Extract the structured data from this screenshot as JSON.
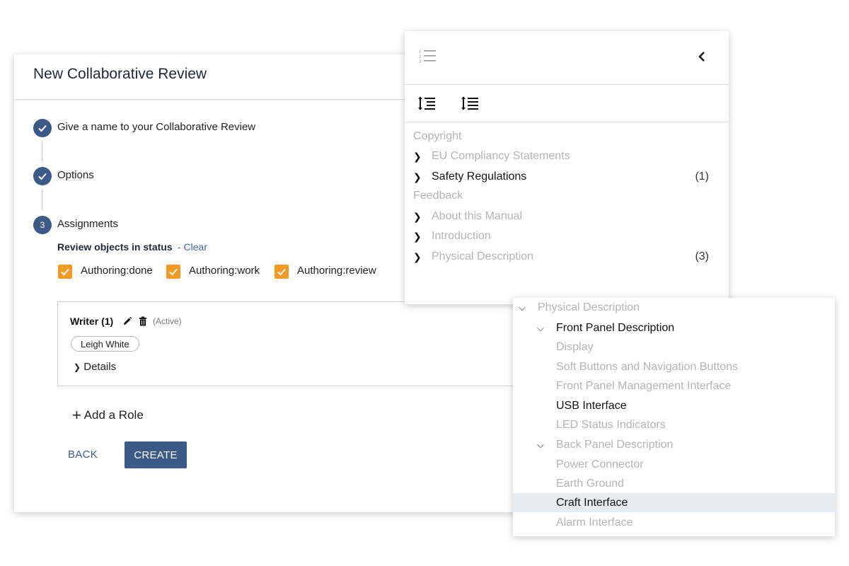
{
  "dialog": {
    "title": "New Collaborative Review",
    "steps": [
      {
        "label": "Give a name to your Collaborative Review",
        "state": "done"
      },
      {
        "label": "Options",
        "state": "done"
      },
      {
        "label": "Assignments",
        "number": "3",
        "state": "active"
      }
    ],
    "status_title": "Review objects in status",
    "clear_link": "- Clear",
    "checkboxes": [
      {
        "label": "Authoring:done",
        "checked": true
      },
      {
        "label": "Authoring:work",
        "checked": true
      },
      {
        "label": "Authoring:review",
        "checked": true
      }
    ],
    "role": {
      "title": "Writer (1)",
      "status": "(Active)",
      "member": "Leigh White",
      "details": "Details"
    },
    "add_role": "Add a Role",
    "back_label": "BACK",
    "create_label": "CREATE"
  },
  "toc": {
    "items": [
      {
        "label": "Copyright",
        "expandable": false,
        "muted": true,
        "count": ""
      },
      {
        "label": "EU Compliancy Statements",
        "expandable": true,
        "muted": true,
        "count": ""
      },
      {
        "label": "Safety Regulations",
        "expandable": true,
        "muted": false,
        "count": "(1)"
      },
      {
        "label": "Feedback",
        "expandable": false,
        "muted": true,
        "count": ""
      },
      {
        "label": "About this Manual",
        "expandable": true,
        "muted": true,
        "count": ""
      },
      {
        "label": "Introduction",
        "expandable": true,
        "muted": true,
        "count": ""
      },
      {
        "label": "Physical Description",
        "expandable": true,
        "muted": true,
        "count": "(3)"
      }
    ]
  },
  "tree": {
    "items": [
      {
        "label": "Physical Description",
        "level": 0,
        "expanded": true,
        "muted": true
      },
      {
        "label": "Front Panel Description",
        "level": 1,
        "expanded": true,
        "muted": false
      },
      {
        "label": "Display",
        "level": 2,
        "muted": true
      },
      {
        "label": "Soft Buttons and Navigation Buttons",
        "level": 2,
        "muted": true
      },
      {
        "label": "Front Panel Management Interface",
        "level": 2,
        "muted": true
      },
      {
        "label": "USB Interface",
        "level": 2,
        "muted": false
      },
      {
        "label": "LED Status Indicators",
        "level": 2,
        "muted": true
      },
      {
        "label": "Back Panel Description",
        "level": 1,
        "expanded": true,
        "muted": true
      },
      {
        "label": "Power Connector",
        "level": 2,
        "muted": true
      },
      {
        "label": "Earth Ground",
        "level": 2,
        "muted": true
      },
      {
        "label": "Craft Interface",
        "level": 2,
        "muted": false,
        "selected": true
      },
      {
        "label": "Alarm Interface",
        "level": 2,
        "muted": true
      }
    ]
  },
  "colors": {
    "accent": "#3c5a88",
    "checkbox": "#f29a24",
    "link": "#3b6ba8",
    "muted_text": "#b4b4b4",
    "selected_row": "#e7ecf0"
  }
}
